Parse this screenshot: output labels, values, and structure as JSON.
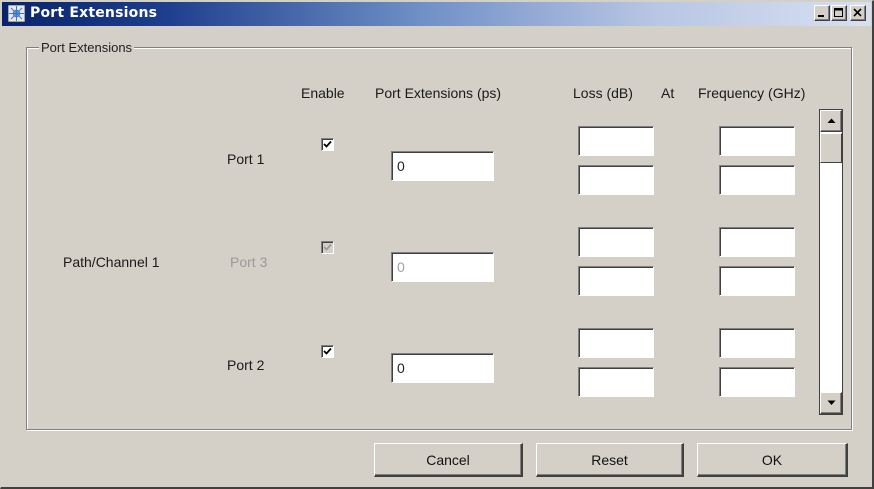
{
  "window": {
    "title": "Port Extensions"
  },
  "group": {
    "legend": "Port Extensions"
  },
  "headers": {
    "enable": "Enable",
    "port_extensions": "Port Extensions  (ps)",
    "loss": "Loss (dB)",
    "at": "At",
    "frequency": "Frequency (GHz)"
  },
  "path_label": "Path/Channel 1",
  "ports": [
    {
      "label": "Port 1",
      "enabled": true,
      "disabled_row": false,
      "extension_value": "0",
      "loss": [
        "",
        ""
      ],
      "frequency": [
        "",
        ""
      ]
    },
    {
      "label": "Port 3",
      "enabled": true,
      "disabled_row": true,
      "extension_value": "0",
      "loss": [
        "",
        ""
      ],
      "frequency": [
        "",
        ""
      ]
    },
    {
      "label": "Port 2",
      "enabled": true,
      "disabled_row": false,
      "extension_value": "0",
      "loss": [
        "",
        ""
      ],
      "frequency": [
        "",
        ""
      ]
    }
  ],
  "buttons": {
    "cancel": "Cancel",
    "reset": "Reset",
    "ok": "OK"
  },
  "icons": {
    "app": "network-analyzer-icon",
    "minimize": "minimize-icon",
    "maximize": "maximize-icon",
    "close": "close-icon",
    "scroll_up": "arrow-up-icon",
    "scroll_down": "arrow-down-icon",
    "check": "checkmark-icon"
  },
  "colors": {
    "title_bar": "#0a246a",
    "face": "#d4d0c8",
    "disabled_text": "#9a9a9a"
  }
}
